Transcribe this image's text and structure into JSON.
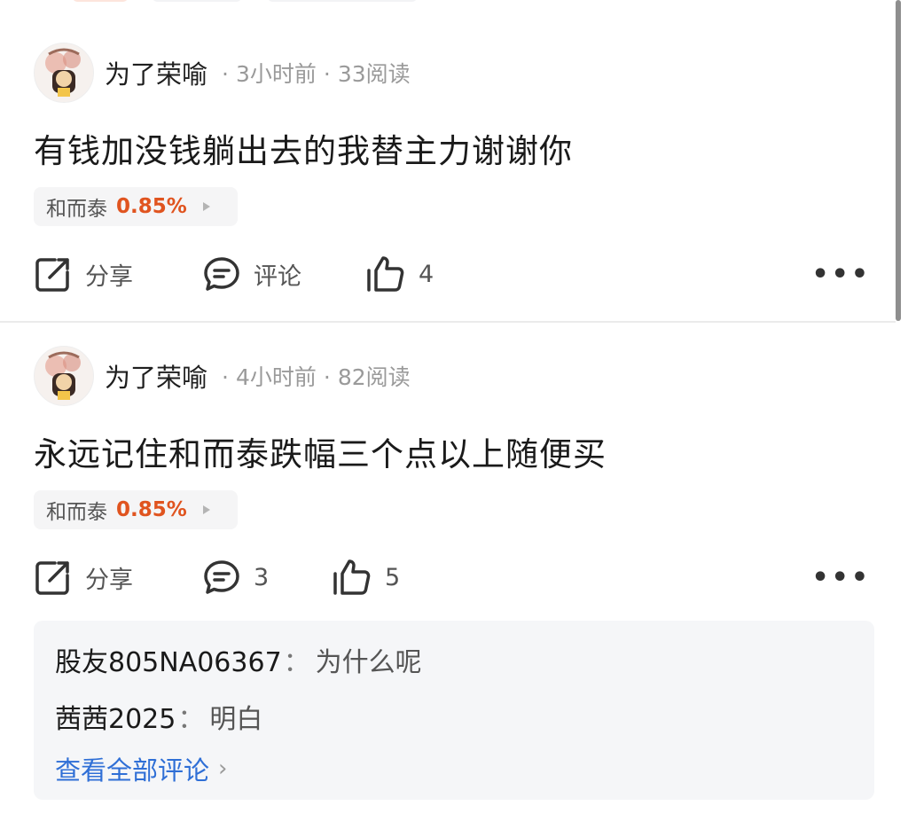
{
  "posts": [
    {
      "author": "为了荣喻",
      "time": "3小时前",
      "reads": "33阅读",
      "content": "有钱加没钱躺出去的我替主力谢谢你",
      "stock": {
        "name": "和而泰",
        "change": "0.85%"
      },
      "actions": {
        "share": "分享",
        "comment": "评论",
        "likes": "4"
      }
    },
    {
      "author": "为了荣喻",
      "time": "4小时前",
      "reads": "82阅读",
      "content": "永远记住和而泰跌幅三个点以上随便买",
      "stock": {
        "name": "和而泰",
        "change": "0.85%"
      },
      "actions": {
        "share": "分享",
        "comment": "3",
        "likes": "5"
      },
      "comments": [
        {
          "user": "股友805NA06367",
          "text": "为什么呢"
        },
        {
          "user": "茜茜2025",
          "text": "明白"
        }
      ],
      "view_all": "查看全部评论"
    }
  ],
  "meta_separator": "·",
  "colon": "：",
  "colors": {
    "accent_red": "#e0541f",
    "link_blue": "#2f6fd6"
  },
  "icons": [
    "share-icon",
    "comment-icon",
    "like-icon",
    "more-icon",
    "chevron-right-icon"
  ]
}
